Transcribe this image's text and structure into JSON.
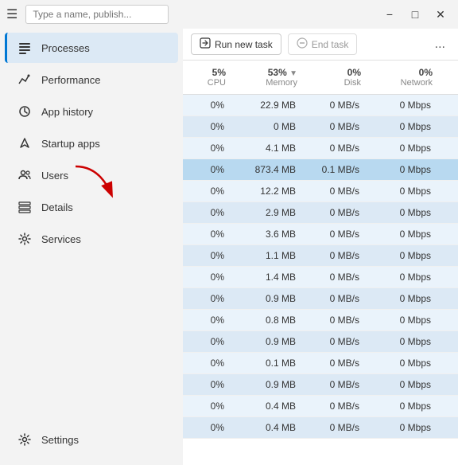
{
  "titleBar": {
    "searchPlaceholder": "Type a name, publish...",
    "minimize": "−",
    "maximize": "□",
    "close": "✕"
  },
  "toolbar": {
    "runNewTask": "Run new task",
    "endTask": "End task",
    "moreOptions": "..."
  },
  "tableHeader": {
    "cpu": {
      "label": "5%",
      "sub": "CPU"
    },
    "memory": {
      "label": "53%",
      "sub": "Memory"
    },
    "disk": {
      "label": "0%",
      "sub": "Disk"
    },
    "network": {
      "label": "0%",
      "sub": "Network"
    }
  },
  "sidebar": {
    "hamburger": "☰",
    "items": [
      {
        "id": "processes",
        "label": "Processes",
        "icon": "list",
        "active": true
      },
      {
        "id": "performance",
        "label": "Performance",
        "icon": "chart"
      },
      {
        "id": "app-history",
        "label": "App history",
        "icon": "clock"
      },
      {
        "id": "startup-apps",
        "label": "Startup apps",
        "icon": "rocket"
      },
      {
        "id": "users",
        "label": "Users",
        "icon": "users"
      },
      {
        "id": "details",
        "label": "Details",
        "icon": "details"
      },
      {
        "id": "services",
        "label": "Services",
        "icon": "gear"
      }
    ],
    "settings": {
      "id": "settings",
      "label": "Settings",
      "icon": "settings"
    }
  },
  "tableRows": [
    {
      "cpu": "0%",
      "memory": "22.9 MB",
      "disk": "0 MB/s",
      "network": "0 Mbps",
      "highlighted": false
    },
    {
      "cpu": "0%",
      "memory": "0 MB",
      "disk": "0 MB/s",
      "network": "0 Mbps",
      "highlighted": false
    },
    {
      "cpu": "0%",
      "memory": "4.1 MB",
      "disk": "0 MB/s",
      "network": "0 Mbps",
      "highlighted": false
    },
    {
      "cpu": "0%",
      "memory": "873.4 MB",
      "disk": "0.1 MB/s",
      "network": "0 Mbps",
      "highlighted": true
    },
    {
      "cpu": "0%",
      "memory": "12.2 MB",
      "disk": "0 MB/s",
      "network": "0 Mbps",
      "highlighted": false
    },
    {
      "cpu": "0%",
      "memory": "2.9 MB",
      "disk": "0 MB/s",
      "network": "0 Mbps",
      "highlighted": false
    },
    {
      "cpu": "0%",
      "memory": "3.6 MB",
      "disk": "0 MB/s",
      "network": "0 Mbps",
      "highlighted": false
    },
    {
      "cpu": "0%",
      "memory": "1.1 MB",
      "disk": "0 MB/s",
      "network": "0 Mbps",
      "highlighted": false
    },
    {
      "cpu": "0%",
      "memory": "1.4 MB",
      "disk": "0 MB/s",
      "network": "0 Mbps",
      "highlighted": false
    },
    {
      "cpu": "0%",
      "memory": "0.9 MB",
      "disk": "0 MB/s",
      "network": "0 Mbps",
      "highlighted": false
    },
    {
      "cpu": "0%",
      "memory": "0.8 MB",
      "disk": "0 MB/s",
      "network": "0 Mbps",
      "highlighted": false
    },
    {
      "cpu": "0%",
      "memory": "0.9 MB",
      "disk": "0 MB/s",
      "network": "0 Mbps",
      "highlighted": false
    },
    {
      "cpu": "0%",
      "memory": "0.1 MB",
      "disk": "0 MB/s",
      "network": "0 Mbps",
      "highlighted": false
    },
    {
      "cpu": "0%",
      "memory": "0.9 MB",
      "disk": "0 MB/s",
      "network": "0 Mbps",
      "highlighted": false
    },
    {
      "cpu": "0%",
      "memory": "0.4 MB",
      "disk": "0 MB/s",
      "network": "0 Mbps",
      "highlighted": false
    },
    {
      "cpu": "0%",
      "memory": "0.4 MB",
      "disk": "0 MB/s",
      "network": "0 Mbps",
      "highlighted": false
    }
  ]
}
